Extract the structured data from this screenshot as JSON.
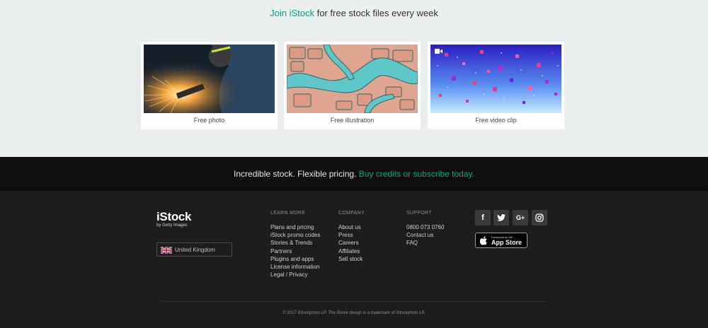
{
  "promo": {
    "join_label": "Join iStock",
    "headline_rest": " for free stock files every week",
    "cards": [
      {
        "caption": "Free photo",
        "thumb": "welding-sparks-photo"
      },
      {
        "caption": "Free illustration",
        "thumb": "river-map-illustration"
      },
      {
        "caption": "Free video clip",
        "thumb": "floating-cubes-video"
      }
    ]
  },
  "cta": {
    "text": "Incredible stock. Flexible pricing. ",
    "link": "Buy credits or subscribe today."
  },
  "footer": {
    "logo": {
      "brand": "iStock",
      "sub": "by Getty Images"
    },
    "region": "United Kingdom",
    "learn_more": {
      "title": "LEARN MORE",
      "links": [
        "Plans and pricing",
        "iStock promo codes",
        "Stories & Trends",
        "Partners",
        "Plugins and apps",
        "License information",
        "Legal / Privacy"
      ]
    },
    "company": {
      "title": "COMPANY",
      "links": [
        "About us",
        "Press",
        "Careers",
        "Affiliates",
        "Sell stock"
      ]
    },
    "support": {
      "title": "SUPPORT",
      "links": [
        "0800 073 0760",
        "Contact us",
        "FAQ"
      ]
    },
    "socials": [
      {
        "icon": "facebook-icon",
        "glyph": "f"
      },
      {
        "icon": "twitter-icon",
        "glyph": "t"
      },
      {
        "icon": "google-plus-icon",
        "glyph": "G+"
      },
      {
        "icon": "instagram-icon",
        "glyph": "◎"
      }
    ],
    "app_store": {
      "small": "Download on the",
      "big": "App Store"
    },
    "copyright": "© 2017 iStockphoto LP. The iStock design is a trademark of iStockphoto LP."
  },
  "colors": {
    "accent": "#0b9c7f",
    "promo_bg": "#ebeeee",
    "footer_bg": "#1d1d1d",
    "bar_bg": "#0f0f0f"
  }
}
